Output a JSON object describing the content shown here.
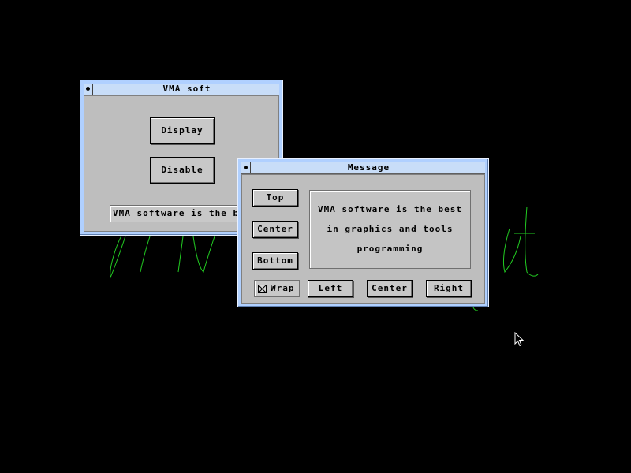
{
  "desktop": {
    "background_color": "#000000",
    "scribble_color": "#22cc22"
  },
  "vma_window": {
    "title": "VMA soft",
    "display_button": "Display",
    "disable_button": "Disable",
    "text_field_value": "VMA software is the best"
  },
  "message_window": {
    "title": "Message",
    "top_button": "Top",
    "center_button": "Center",
    "bottom_button": "Bottom",
    "message_lines": [
      "VMA software is the best",
      "in graphics and tools",
      "programming"
    ],
    "wrap_label": "Wrap",
    "wrap_checked": true,
    "left_button": "Left",
    "center_align_button": "Center",
    "right_button": "Right"
  },
  "colors": {
    "window_frame": "#b0d0ff",
    "title_bar": "#c8ddf8",
    "client_area": "#c4c4c4"
  }
}
